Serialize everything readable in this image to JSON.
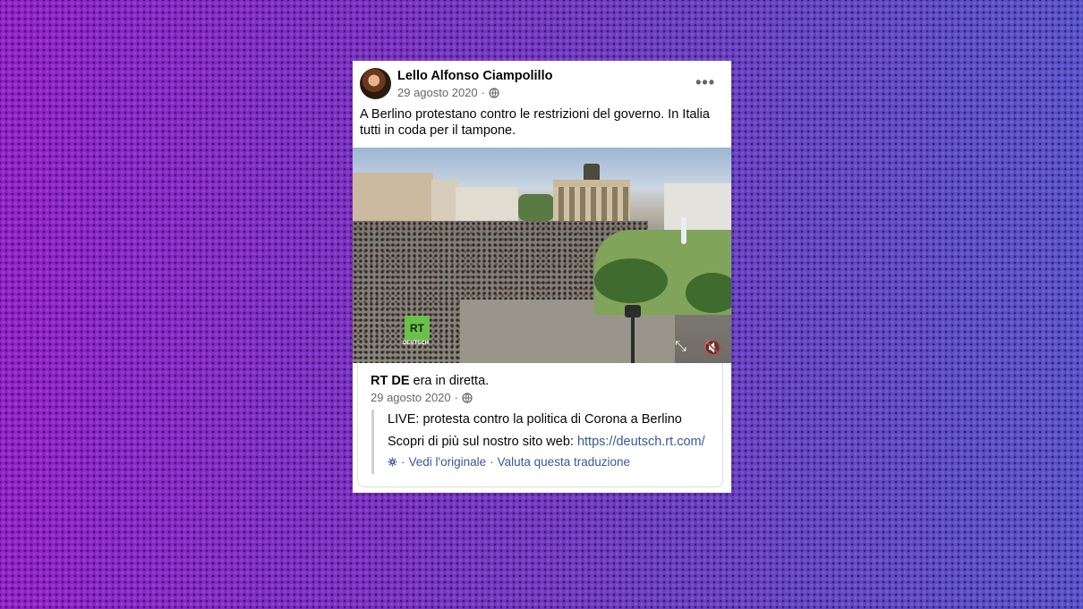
{
  "post": {
    "author": "Lello Alfonso Ciampolillo",
    "date": "29 agosto 2020",
    "date_separator": "·",
    "more_label": "•••",
    "caption": "A Berlino protestano contro le restrizioni del governo. In Italia tutti in coda per il tampone."
  },
  "video": {
    "logo_text": "RT",
    "logo_subtext": "DEUTSCH"
  },
  "shared": {
    "page_name": "RT DE",
    "status_text": "era in diretta.",
    "date": "29 agosto 2020",
    "date_separator": "·",
    "title_line": "LIVE: protesta contro la politica di Corona a Berlino",
    "body_prefix": "Scopri di più sul nostro sito web:",
    "link": "https://deutsch.rt.com/",
    "separator": "·",
    "see_original": "Vedi l'originale",
    "rate_translation": "Valuta questa traduzione"
  },
  "colors": {
    "link": "#385898",
    "rt_green": "#6cc04a",
    "text": "#050505",
    "meta": "#65676b"
  }
}
